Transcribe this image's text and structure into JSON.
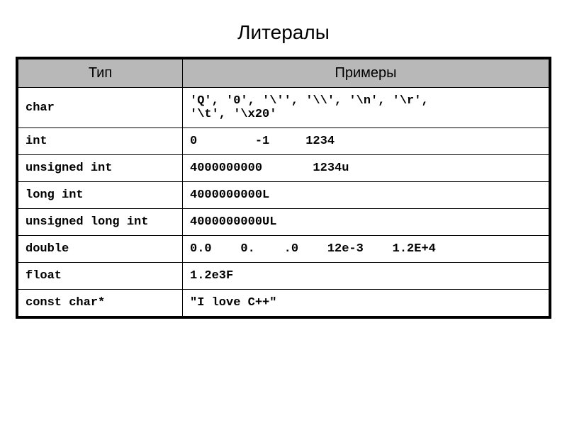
{
  "title": "Литералы",
  "headers": {
    "type": "Тип",
    "examples": "Примеры"
  },
  "rows": [
    {
      "type": "char",
      "examples": "'Q', '0', '\\'', '\\\\', '\\n', '\\r',\n'\\t', '\\x20'"
    },
    {
      "type": "int",
      "examples": "0        -1     1234"
    },
    {
      "type": "unsigned int",
      "examples": "4000000000       1234u"
    },
    {
      "type": "long int",
      "examples": "4000000000L"
    },
    {
      "type": "unsigned long int",
      "examples": "4000000000UL"
    },
    {
      "type": "double",
      "examples": "0.0    0.    .0    12e-3    1.2E+4"
    },
    {
      "type": "float",
      "examples": "1.2e3F"
    },
    {
      "type": "const char*",
      "examples": "\"I love C++\""
    }
  ]
}
